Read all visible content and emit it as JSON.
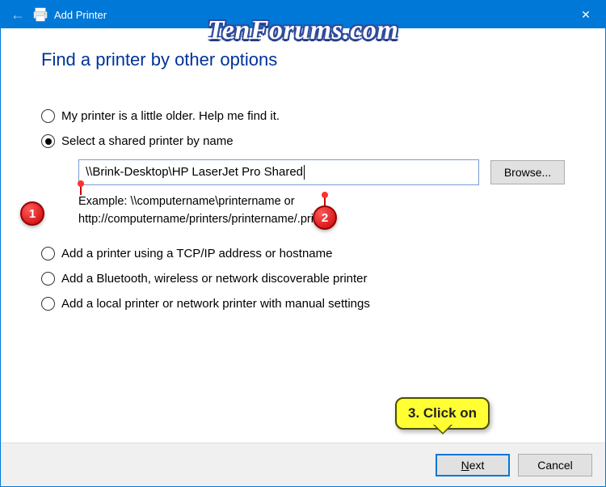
{
  "titlebar": {
    "title": "Add Printer",
    "close": "✕"
  },
  "watermark": "TenForums.com",
  "heading": "Find a printer by other options",
  "options": {
    "older": "My printer is a little older. Help me find it.",
    "shared": "Select a shared printer by name",
    "shared_path": "\\\\Brink-Desktop\\HP LaserJet Pro Shared",
    "browse": "Browse...",
    "example_l1": "Example: \\\\computername\\printername or",
    "example_l2": "http://computername/printers/printername/.printer",
    "tcpip": "Add a printer using a TCP/IP address or hostname",
    "bluetooth": "Add a Bluetooth, wireless or network discoverable printer",
    "local": "Add a local printer or network printer with manual settings"
  },
  "footer": {
    "next": "Next",
    "cancel": "Cancel"
  },
  "annotations": {
    "m1": "1",
    "m2": "2",
    "callout": "3. Click on"
  }
}
